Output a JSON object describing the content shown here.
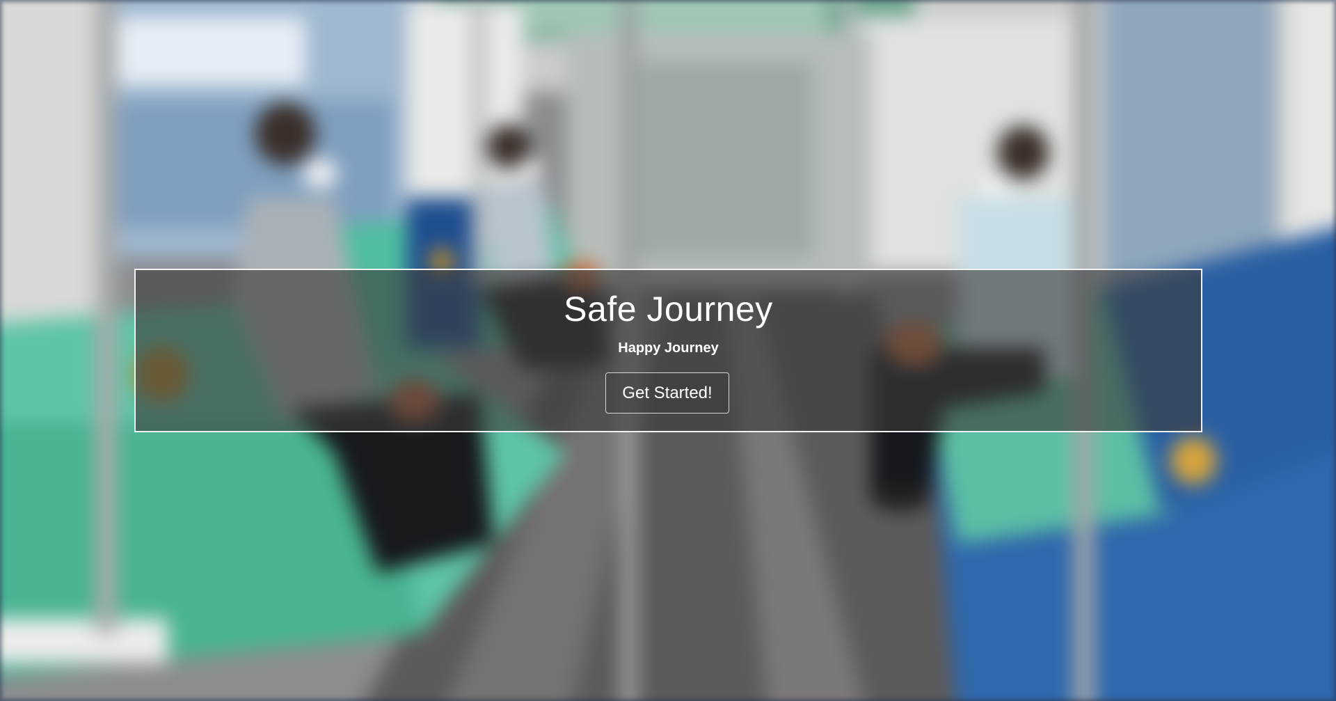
{
  "hero": {
    "title": "Safe Journey",
    "subtitle": "Happy Journey",
    "cta_label": "Get Started!",
    "background_image": "blurred-metro-train-interior-photo"
  },
  "colors": {
    "overlay": "#3c3c3c",
    "text": "#ffffff",
    "border": "#f2f2f2",
    "seat_teal": "#5cc5a8",
    "seat_blue": "#2a63a8"
  }
}
